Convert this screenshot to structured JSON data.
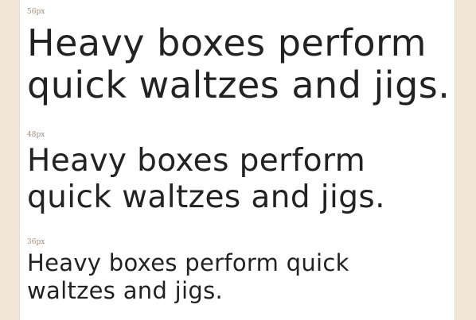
{
  "specimens": [
    {
      "size_label": "56px",
      "text_line1": "Heavy boxes perform",
      "text_line2": "quick waltzes and jigs."
    },
    {
      "size_label": "48px",
      "text_line1": "Heavy boxes perform",
      "text_line2": "quick waltzes and jigs."
    },
    {
      "size_label": "36px",
      "text_line1": "Heavy boxes perform quick",
      "text_line2": "waltzes and jigs."
    }
  ],
  "colors": {
    "background": "#f2e6d6",
    "page": "#ffffff",
    "label": "#a08a7a",
    "text": "#222222"
  }
}
